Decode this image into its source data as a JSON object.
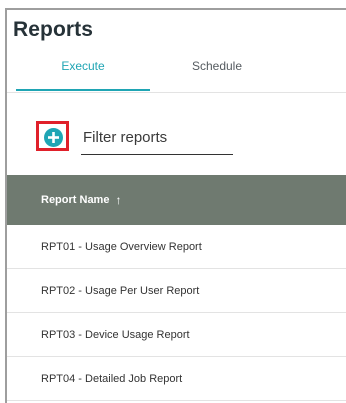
{
  "page": {
    "title": "Reports"
  },
  "tabs": [
    {
      "label": "Execute",
      "active": true
    },
    {
      "label": "Schedule",
      "active": false
    }
  ],
  "filter": {
    "placeholder": "Filter reports",
    "value": ""
  },
  "add_button": {
    "icon": "plus-circle-icon",
    "color": "#1fa5b4",
    "highlight_color": "#e0202a"
  },
  "table": {
    "header": {
      "label": "Report Name",
      "sort_icon": "↑",
      "background": "#6f7a70"
    },
    "rows": [
      {
        "name": "RPT01 - Usage Overview Report"
      },
      {
        "name": "RPT02 - Usage Per User Report"
      },
      {
        "name": "RPT03 - Device Usage Report"
      },
      {
        "name": "RPT04 - Detailed Job Report"
      }
    ]
  },
  "colors": {
    "accent": "#1fa5b4",
    "title": "#263238"
  }
}
